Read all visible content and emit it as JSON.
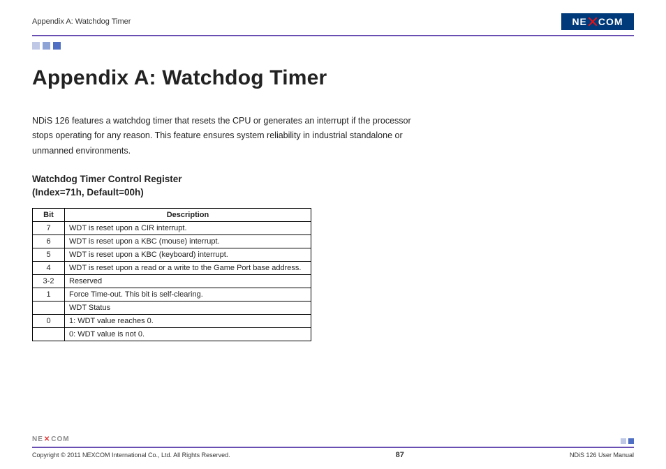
{
  "header": {
    "section": "Appendix A: Watchdog Timer",
    "brand_left": "NE",
    "brand_right": "COM"
  },
  "title": "Appendix A: Watchdog Timer",
  "intro": "NDiS 126 features a watchdog timer that resets the CPU or generates an interrupt if the processor stops operating for any reason. This feature ensures system reliability in industrial standalone or unmanned environments.",
  "subheading_line1": "Watchdog Timer Control Register",
  "subheading_line2": "(Index=71h, Default=00h)",
  "table": {
    "headers": {
      "bit": "Bit",
      "desc": "Description"
    },
    "rows": [
      {
        "bit": "7",
        "desc": "WDT is reset upon a CIR interrupt."
      },
      {
        "bit": "6",
        "desc": "WDT is reset upon a KBC (mouse) interrupt."
      },
      {
        "bit": "5",
        "desc": "WDT is reset upon a KBC (keyboard) interrupt."
      },
      {
        "bit": "4",
        "desc": "WDT is reset upon a read or a write to the Game Port base address."
      },
      {
        "bit": "3-2",
        "desc": "Reserved"
      },
      {
        "bit": "1",
        "desc": "Force Time-out. This bit is self-clearing."
      },
      {
        "bit": "",
        "desc": "WDT Status"
      },
      {
        "bit": "0",
        "desc": "1: WDT value reaches 0."
      },
      {
        "bit": "",
        "desc": "0: WDT value is not 0."
      }
    ]
  },
  "footer": {
    "copyright": "Copyright © 2011 NEXCOM International Co., Ltd. All Rights Reserved.",
    "page": "87",
    "manual": "NDiS 126 User Manual",
    "mini_left": "NE",
    "mini_right": "COM"
  }
}
